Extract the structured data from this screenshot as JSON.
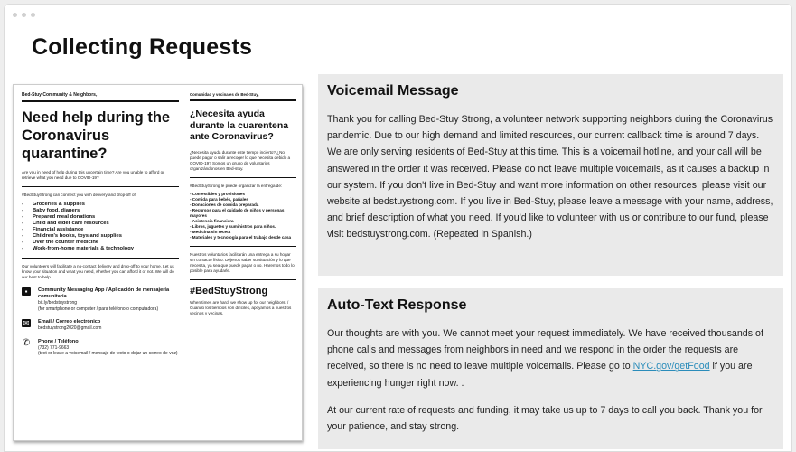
{
  "page": {
    "title": "Collecting Requests"
  },
  "flyer": {
    "header_en": "Bed-Stuy Community & Neighbors,",
    "header_es": "Comunidad y vecinales de Bed-Stuy,",
    "headline_en": "Need help during the Coronavirus quarantine?",
    "headline_es": "¿Necesita ayuda durante la cuarentena ante Coronavirus?",
    "intro_en": "Are you in need of help during this uncertain time? Are you unable to afford or retrieve what you need due to COVID-19?",
    "intro_es": "¿Necesita ayuda durante este tiempo incierto? ¿No puede pagar o salir a recoger lo que necesita debido a COVID-19? Somos un grupo de voluntarios organizándonos en Bed-stuy.",
    "offer_en": "#BedStuyStrong can connect you with delivery and drop-off of:",
    "offer_es": "#BedStuyStrong le puede organizar la entrega de:",
    "items_en": [
      "Groceries & supplies",
      "Baby food, diapers",
      "Prepared meal donations",
      "Child and elder care resources",
      "Financial assistance",
      "Children's books, toys and supplies",
      "Over the counter medicine",
      "Work-from-home materials & technology"
    ],
    "items_es": [
      "- Comestibles y provisiones",
      "- Comida para bebés, pañales",
      "- Donaciones de comida preparada",
      "- Recursos para el cuidado de niños y personas mayores",
      "- Asistencia financiera",
      "- Libros, juguetes y suministros para niños.",
      "- Medicina sin receta",
      "- Materiales y tecnología para el trabajo desde casa"
    ],
    "volunteers_en": "Our volunteers will facilitate a no-contact delivery and drop-off to your home. Let us know your situation and what you need, whether you can afford it or not. We will do our best to help.",
    "volunteers_es": "Nuestros voluntarios facilitarán una entrega a su hogar sin contacto físico. Déjenos saber su situación y lo que necesita, ya sea que puede pagar o no. Haremos todo lo posible para ayudarle.",
    "contact_app_title": "Community Messaging App / Aplicación de mensajería comunitaria",
    "contact_app_text": "bit.ly/bedstuystrong",
    "contact_app_note": "(for smartphone or computer / para teléfono o computadora)",
    "contact_email_title": "Email / Correo electrónico",
    "contact_email_text": "bedstuystrong2020@gmail.com",
    "contact_phone_title": "Phone / Teléfono",
    "contact_phone_text": "(732) 771-9663",
    "contact_phone_note": "(text or leave a voicemail / mensaje de texto o dejar un correo de voz)",
    "hashtag": "#BedStuyStrong",
    "closing_es": "When times are hard, we show up for our neighbors. / Cuando los tiempos son difíciles, apoyamos a nuestros vecinos y vecinas."
  },
  "voicemail": {
    "heading": "Voicemail Message",
    "body": "Thank you for calling Bed-Stuy Strong, a volunteer network supporting neighbors during the Coronavirus pandemic. Due to our high demand and limited resources, our current callback time is around 7 days. We are only serving residents of Bed-Stuy at this time. This is a voicemail hotline, and your call will be answered in the order it was received. Please do not leave multiple voicemails, as it causes a backup in our system. If you don't live in Bed-Stuy and want more information on other resources, please visit our website at bedstuystrong.com. If you live in Bed-Stuy, please leave a message with your name, address, and brief description of what you need. If you'd like to volunteer with us or contribute to our fund, please visit bedstuystrong.com. (Repeated in Spanish.)"
  },
  "autotext": {
    "heading": "Auto-Text Response",
    "body_before_link": "Our thoughts are with you. We cannot meet your request immediately. We have received thousands of phone calls and messages from neighbors in need and we respond in the order the requests are received, so there is no need to leave multiple voicemails. Please go to ",
    "link_text": "NYC.gov/getFood",
    "body_after_link": " if you are experiencing hunger right now. .",
    "body_2": "At our current rate of requests and funding, it may take us up to 7 days to call you back. Thank you for your patience, and stay strong."
  },
  "colors": {
    "panel_bg": "#eaeaea",
    "link": "#2a8cba"
  }
}
